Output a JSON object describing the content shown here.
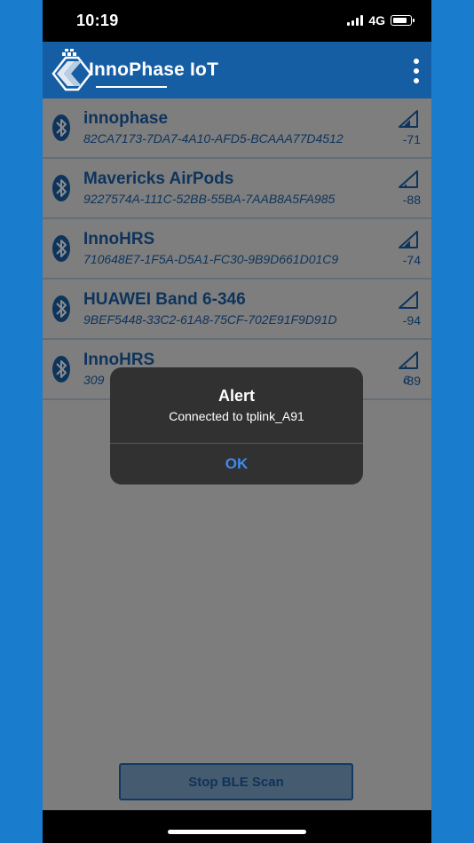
{
  "status_bar": {
    "time": "10:19",
    "network": "4G"
  },
  "app_bar": {
    "title": "InnoPhase IoT"
  },
  "devices": [
    {
      "name": "innophase",
      "uuid": "82CA7173-7DA7-4A10-AFD5-BCAAA77D4512",
      "rssi": "-71"
    },
    {
      "name": "Mavericks AirPods",
      "uuid": "9227574A-111C-52BB-55BA-7AAB8A5FA985",
      "rssi": "-88"
    },
    {
      "name": "InnoHRS",
      "uuid": "710648E7-1F5A-D5A1-FC30-9B9D661D01C9",
      "rssi": "-74"
    },
    {
      "name": "HUAWEI Band 6-346",
      "uuid": "9BEF5448-33C2-61A8-75CF-702E91F9D91D",
      "rssi": "-94"
    },
    {
      "name": "InnoHRS",
      "uuid": "309",
      "uuid_tail": "6",
      "rssi": "-89"
    }
  ],
  "scan_button": {
    "label": "Stop BLE Scan"
  },
  "alert": {
    "title": "Alert",
    "message": "Connected to tplink_A91",
    "ok_label": "OK"
  },
  "colors": {
    "app_bar": "#165ea4",
    "accent_text": "#1b5fa8",
    "alert_button": "#3d8bf0",
    "background": "#1a7ccc"
  }
}
